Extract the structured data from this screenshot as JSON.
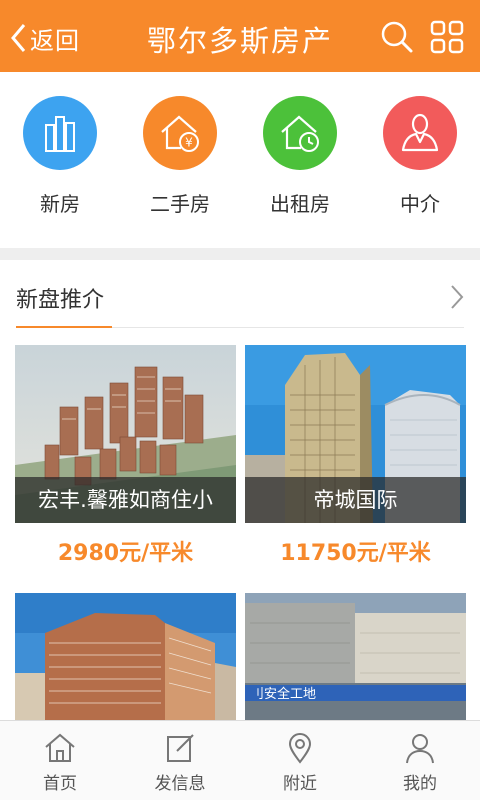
{
  "header": {
    "back_label": "返回",
    "title": "鄂尔多斯房产",
    "search_icon": "search-icon",
    "menu_icon": "grid-menu-icon"
  },
  "categories": [
    {
      "label": "新房",
      "color": "#3da3f0",
      "icon": "buildings-icon"
    },
    {
      "label": "二手房",
      "color": "#f7892b",
      "icon": "house-yuan-icon"
    },
    {
      "label": "出租房",
      "color": "#4cc13a",
      "icon": "house-clock-icon"
    },
    {
      "label": "中介",
      "color": "#f25b5b",
      "icon": "agent-icon"
    }
  ],
  "section": {
    "title": "新盘推介",
    "accent": "#f7892b"
  },
  "listings": [
    {
      "name": "宏丰.馨雅如商住小",
      "price": "2980元/平米"
    },
    {
      "name": "帝城国际",
      "price": "11750元/平米"
    },
    {
      "name": "",
      "price": ""
    },
    {
      "name": "",
      "price": ""
    }
  ],
  "bottom_nav": [
    {
      "label": "首页",
      "icon": "home-icon"
    },
    {
      "label": "发信息",
      "icon": "edit-icon"
    },
    {
      "label": "附近",
      "icon": "location-pin-icon"
    },
    {
      "label": "我的",
      "icon": "user-icon"
    }
  ]
}
